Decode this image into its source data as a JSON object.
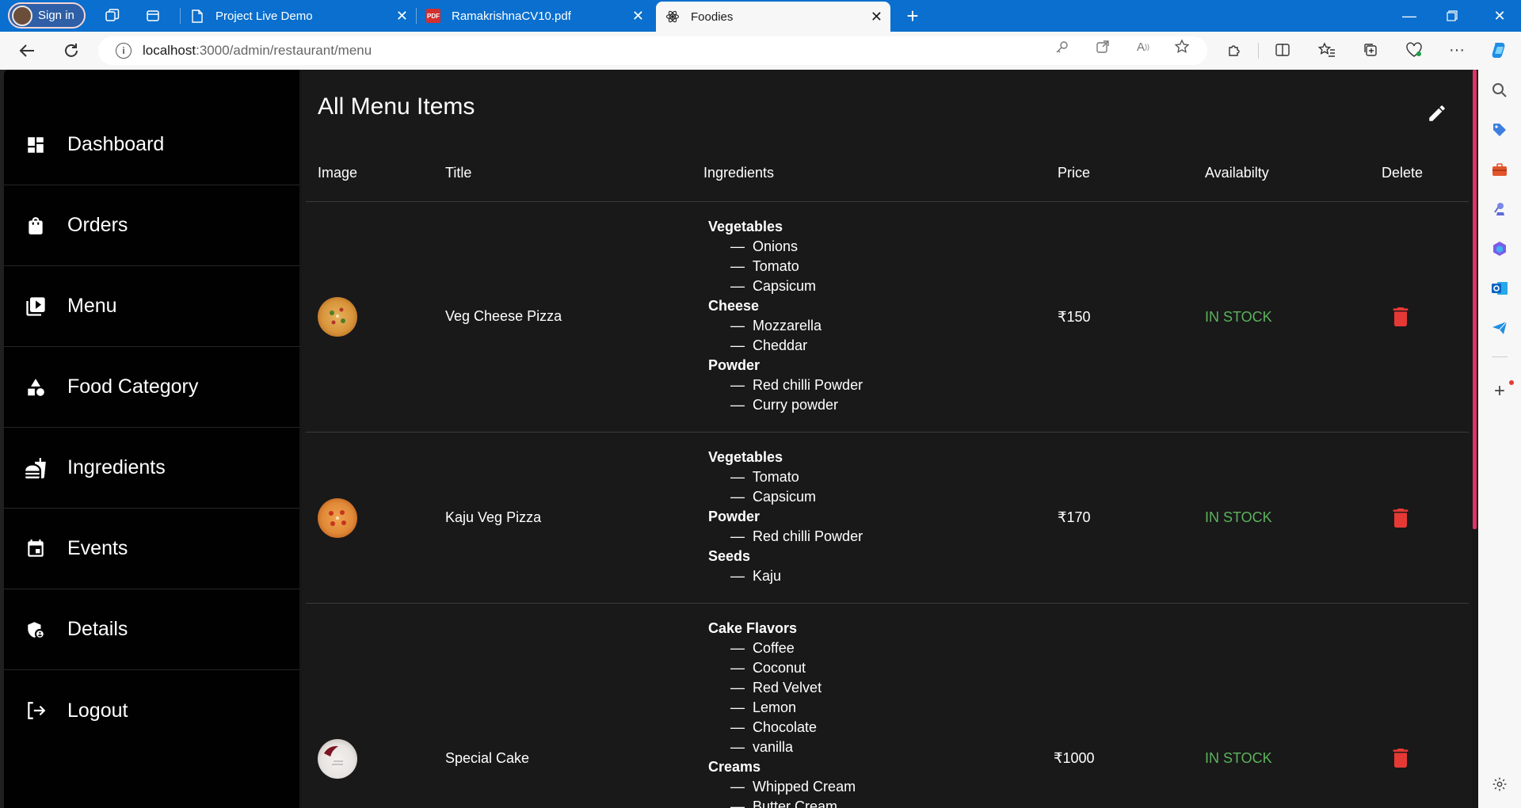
{
  "browser": {
    "signin_label": "Sign in",
    "tabs": [
      {
        "title": "Project Live Demo",
        "icon": "page-icon"
      },
      {
        "title": "RamakrishnaCV10.pdf",
        "icon": "pdf-icon"
      },
      {
        "title": "Foodies",
        "icon": "react-icon",
        "active": true
      }
    ],
    "url_host": "localhost",
    "url_path": ":3000/admin/restaurant/menu"
  },
  "sidebar": {
    "items": [
      {
        "label": "Dashboard",
        "icon": "dashboard-icon"
      },
      {
        "label": "Orders",
        "icon": "shopping-bag-icon"
      },
      {
        "label": "Menu",
        "icon": "menu-book-icon"
      },
      {
        "label": "Food Category",
        "icon": "category-icon"
      },
      {
        "label": "Ingredients",
        "icon": "fastfood-icon"
      },
      {
        "label": "Events",
        "icon": "event-icon"
      },
      {
        "label": "Details",
        "icon": "admin-panel-icon"
      },
      {
        "label": "Logout",
        "icon": "logout-icon"
      }
    ]
  },
  "main": {
    "title": "All Menu Items",
    "columns": [
      "Image",
      "Title",
      "Ingredients",
      "Price",
      "Availabilty",
      "Delete"
    ],
    "rows": [
      {
        "title": "Veg Cheese Pizza",
        "price": "₹150",
        "availability": "IN STOCK",
        "ingredients": [
          {
            "group": "Vegetables",
            "items": [
              "Onions",
              "Tomato",
              "Capsicum"
            ]
          },
          {
            "group": "Cheese",
            "items": [
              "Mozzarella",
              "Cheddar"
            ]
          },
          {
            "group": "Powder",
            "items": [
              "Red chilli Powder",
              "Curry powder"
            ]
          }
        ]
      },
      {
        "title": "Kaju Veg Pizza",
        "price": "₹170",
        "availability": "IN STOCK",
        "ingredients": [
          {
            "group": "Vegetables",
            "items": [
              "Tomato",
              "Capsicum"
            ]
          },
          {
            "group": "Powder",
            "items": [
              "Red chilli Powder"
            ]
          },
          {
            "group": "Seeds",
            "items": [
              "Kaju"
            ]
          }
        ]
      },
      {
        "title": "Special Cake",
        "price": "₹1000",
        "availability": "IN STOCK",
        "ingredients": [
          {
            "group": "Cake Flavors",
            "items": [
              "Coffee",
              "Coconut",
              "Red Velvet",
              "Lemon",
              "Chocolate",
              "vanilla"
            ]
          },
          {
            "group": "Creams",
            "items": [
              "Whipped Cream",
              "Butter Cream"
            ]
          }
        ]
      }
    ]
  },
  "colors": {
    "accent_tabbar": "#0a6fce",
    "in_stock": "#5cb25d",
    "delete": "#e53935"
  }
}
